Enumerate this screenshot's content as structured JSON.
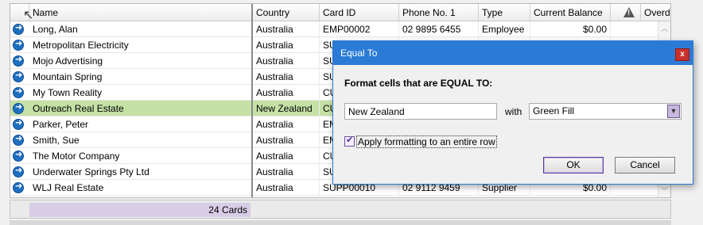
{
  "columns": [
    "Name",
    "Country",
    "Card ID",
    "Phone No. 1",
    "Type",
    "Current Balance",
    "Overdue"
  ],
  "rows": [
    {
      "name": "Long, Alan",
      "country": "Australia",
      "card_id": "EMP00002",
      "phone": "02 9895 6455",
      "type": "Employee",
      "balance": "$0.00"
    },
    {
      "name": "Metropolitan Electricity",
      "country": "Australia",
      "card_id": "SU",
      "phone": "",
      "type": "",
      "balance": ""
    },
    {
      "name": "Mojo Advertising",
      "country": "Australia",
      "card_id": "SU",
      "phone": "",
      "type": "",
      "balance": ""
    },
    {
      "name": "Mountain Spring",
      "country": "Australia",
      "card_id": "SU",
      "phone": "",
      "type": "",
      "balance": ""
    },
    {
      "name": "My Town Reality",
      "country": "Australia",
      "card_id": "CU",
      "phone": "",
      "type": "",
      "balance": ""
    },
    {
      "name": "Outreach Real Estate",
      "country": "New Zealand",
      "card_id": "CU",
      "phone": "",
      "type": "",
      "balance": ""
    },
    {
      "name": "Parker, Peter",
      "country": "Australia",
      "card_id": "EM",
      "phone": "",
      "type": "",
      "balance": ""
    },
    {
      "name": "Smith, Sue",
      "country": "Australia",
      "card_id": "EM",
      "phone": "",
      "type": "",
      "balance": ""
    },
    {
      "name": "The Motor Company",
      "country": "Australia",
      "card_id": "CU",
      "phone": "",
      "type": "",
      "balance": ""
    },
    {
      "name": "Underwater Springs Pty Ltd",
      "country": "Australia",
      "card_id": "SU",
      "phone": "",
      "type": "",
      "balance": ""
    },
    {
      "name": "WLJ Real Estate",
      "country": "Australia",
      "card_id": "SUPP00010",
      "phone": "02 9112 9459",
      "type": "Supplier",
      "balance": "$0.00"
    }
  ],
  "selected_row_index": 5,
  "colors": {
    "selected_row": "#c6e1a6",
    "dialog_title": "#2b7bd6",
    "footer_count_bg": "#d8cde6"
  },
  "footer": {
    "count": "24 Cards"
  },
  "dialog": {
    "title": "Equal To",
    "close_label": "x",
    "heading": "Format cells that are EQUAL TO:",
    "value": "New Zealand",
    "with_label": "with",
    "format_option": "Green Fill",
    "checkbox_label": "Apply formatting to an entire row",
    "checkbox_checked": true,
    "ok_label": "OK",
    "cancel_label": "Cancel"
  }
}
